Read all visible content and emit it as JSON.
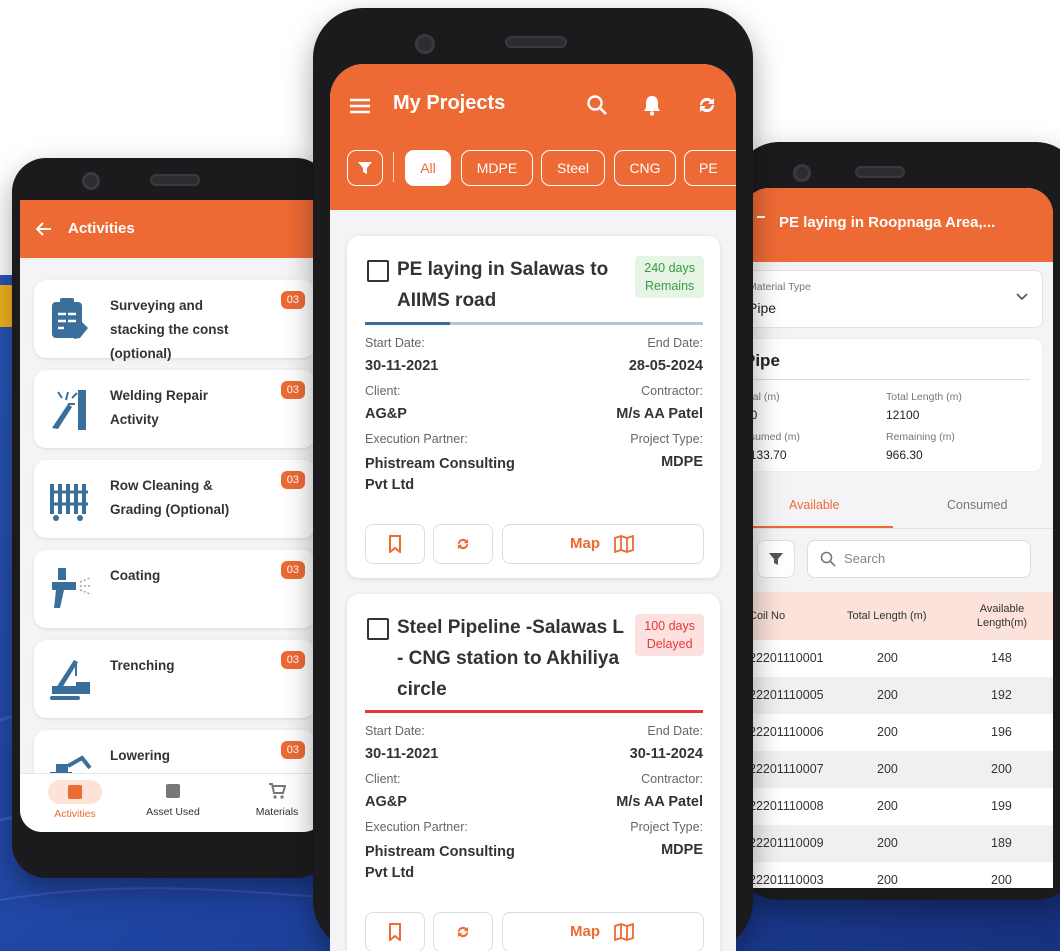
{
  "colors": {
    "accent": "#ee6a35",
    "background_blue": "#1f43a0",
    "green": "#3a9a3f",
    "red": "#e53935"
  },
  "activities_screen": {
    "title": "Activities",
    "back_icon": "arrow-left-icon",
    "items": [
      {
        "label": "Surveying and stacking the const (optional)",
        "count": "03",
        "icon": "clipboard-icon"
      },
      {
        "label": "Welding Repair Activity",
        "count": "03",
        "icon": "welding-icon"
      },
      {
        "label": "Row Cleaning & Grading (Optional)",
        "count": "03",
        "icon": "fence-icon"
      },
      {
        "label": "Coating",
        "count": "03",
        "icon": "spray-gun-icon"
      },
      {
        "label": "Trenching",
        "count": "03",
        "icon": "crane-icon"
      },
      {
        "label": "Lowering",
        "count": "03",
        "icon": "excavator-icon"
      }
    ],
    "bottom_nav": [
      {
        "label": "Activities",
        "icon": "activities-icon",
        "active": true
      },
      {
        "label": "Asset Used",
        "icon": "archive-icon",
        "active": false
      },
      {
        "label": "Materials",
        "icon": "cart-icon",
        "active": false
      }
    ]
  },
  "projects_screen": {
    "title": "My Projects",
    "filters": [
      "All",
      "MDPE",
      "Steel",
      "CNG",
      "PE"
    ],
    "active_filter": "All",
    "projects": [
      {
        "title": "PE laying in Salawas to AIIMS road",
        "status_line1": "240 days",
        "status_line2": "Remains",
        "status": "remains",
        "progress": 0.25,
        "start_label": "Start Date:",
        "start": "30-11-2021",
        "end_label": "End Date:",
        "end": "28-05-2024",
        "client_label": "Client:",
        "client": "AG&P",
        "contractor_label": "Contractor:",
        "contractor": "M/s AA Patel",
        "partner_label": "Execution Partner:",
        "partner": "Phistream Consulting Pvt Ltd",
        "type_label": "Project Type:",
        "type": "MDPE",
        "map_label": "Map"
      },
      {
        "title": "Steel Pipeline -Salawas L - CNG station to Akhiliya circle",
        "status_line1": "100 days",
        "status_line2": "Delayed",
        "status": "delayed",
        "progress": 1.0,
        "start_label": "Start Date:",
        "start": "30-11-2021",
        "end_label": "End Date:",
        "end": "30-11-2024",
        "client_label": "Client:",
        "client": "AG&P",
        "contractor_label": "Contractor:",
        "contractor": "M/s AA Patel",
        "partner_label": "Execution Partner:",
        "partner": "Phistream Consulting Pvt Ltd",
        "type_label": "Project Type:",
        "type": "MDPE",
        "map_label": "Map"
      }
    ]
  },
  "materials_screen": {
    "title": "PE laying in Roopnaga Area,...",
    "material_type_label": "Material Type",
    "material_type_value": "Pipe",
    "summary_title": "Pipe",
    "summary": [
      {
        "label": "otal (m)",
        "value": "00"
      },
      {
        "label": "Total Length (m)",
        "value": "12100"
      },
      {
        "label": "nsumed (m)",
        "value": "1133.70"
      },
      {
        "label": "Remaining (m)",
        "value": "966.30"
      }
    ],
    "tabs": [
      "Available",
      "Consumed"
    ],
    "active_tab": "Available",
    "search_placeholder": "Search",
    "table_headers": [
      "Coil No",
      "Total Length (m)",
      "Available Length(m)"
    ],
    "rows": [
      [
        "22201110001",
        "200",
        "148"
      ],
      [
        "22201110005",
        "200",
        "192"
      ],
      [
        "22201110006",
        "200",
        "196"
      ],
      [
        "22201110007",
        "200",
        "200"
      ],
      [
        "22201110008",
        "200",
        "199"
      ],
      [
        "22201110009",
        "200",
        "189"
      ],
      [
        "22201110003",
        "200",
        "200"
      ]
    ]
  }
}
